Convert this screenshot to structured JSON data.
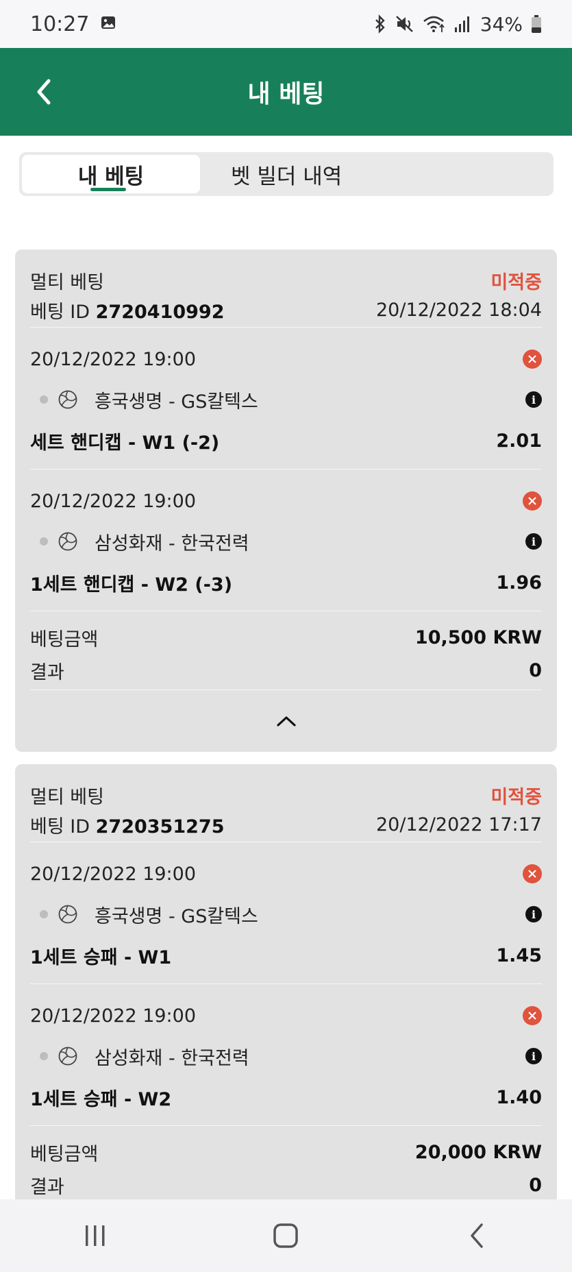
{
  "status_bar": {
    "time": "10:27",
    "battery": "34%"
  },
  "header": {
    "title": "내 베팅"
  },
  "tabs": [
    {
      "label": "내 베팅",
      "active": true
    },
    {
      "label": "벳 빌더 내역",
      "active": false
    }
  ],
  "bets": [
    {
      "type": "멀티 베팅",
      "status": "미적중",
      "id_label": "베팅 ID",
      "id": "2720410992",
      "placed": "20/12/2022 18:04",
      "selections": [
        {
          "date": "20/12/2022 19:00",
          "match": "흥국생명 - GS칼텍스",
          "market": "세트 핸디캡 - W1 (-2)",
          "odds": "2.01"
        },
        {
          "date": "20/12/2022 19:00",
          "match": "삼성화재 - 한국전력",
          "market": "1세트 핸디캡 - W2 (-3)",
          "odds": "1.96"
        }
      ],
      "stake_label": "베팅금액",
      "stake": "10,500 KRW",
      "result_label": "결과",
      "result": "0"
    },
    {
      "type": "멀티 베팅",
      "status": "미적중",
      "id_label": "베팅 ID",
      "id": "2720351275",
      "placed": "20/12/2022 17:17",
      "selections": [
        {
          "date": "20/12/2022 19:00",
          "match": "흥국생명 - GS칼텍스",
          "market": "1세트 승패 - W1",
          "odds": "1.45"
        },
        {
          "date": "20/12/2022 19:00",
          "match": "삼성화재 - 한국전력",
          "market": "1세트 승패 - W2",
          "odds": "1.40"
        }
      ],
      "stake_label": "베팅금액",
      "stake": "20,000 KRW",
      "result_label": "결과",
      "result": "0"
    }
  ],
  "colors": {
    "brand": "#17805a",
    "lost": "#e0533d"
  },
  "icons": [
    "image-icon",
    "bluetooth-icon",
    "mute-icon",
    "wifi-icon",
    "signal-icon",
    "battery-icon",
    "back-icon",
    "lost-icon",
    "volleyball-icon",
    "info-icon",
    "chevron-up-icon",
    "recents-icon",
    "home-icon",
    "nav-back-icon"
  ]
}
